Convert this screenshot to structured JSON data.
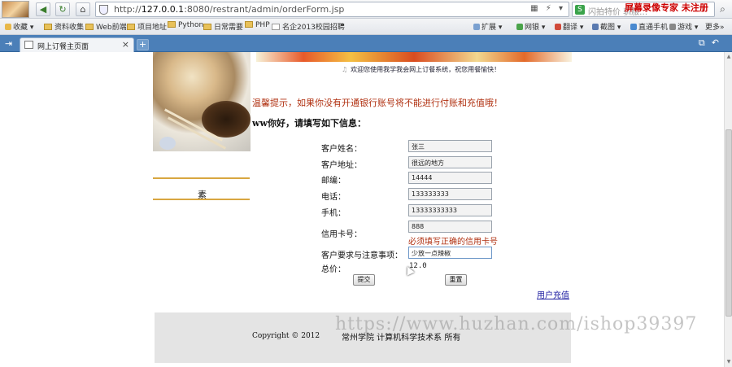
{
  "toolbar": {
    "url_prefix": "http://",
    "url_host": "127.0.0.1",
    "url_rest": ":8080/restrant/admin/orderForm.jsp",
    "search_placeholder": "闪拍特价 驯服…",
    "overlay_watermark": "屏幕录像专家  未注册"
  },
  "bookmarks": {
    "left": [
      "收藏",
      "资料收集",
      "Web前端",
      "项目地址",
      "Python",
      "日常需要",
      "PHP",
      "名企2013校园招聘"
    ],
    "more": "»",
    "right": [
      "扩展",
      "网银",
      "翻译",
      "截图",
      "直通手机",
      "游戏",
      "更多"
    ]
  },
  "tab": {
    "title": "网上订餐主页面",
    "close": "×",
    "new": "+"
  },
  "page": {
    "welcome": "欢迎您使用我学我会网上订餐系统，祝您用餐愉快！",
    "warning": "温馨提示，如果你没有开通银行账号将不能进行付账和充值哦！",
    "greeting": "ww你好，请填写如下信息：",
    "side_text": "素",
    "form": {
      "name_label": "客户姓名：",
      "name_value": "张三",
      "address_label": "客户地址：",
      "address_value": "很远的地方",
      "zip_label": "邮编：",
      "zip_value": "14444",
      "phone_label": "电话：",
      "phone_value": "133333333",
      "mobile_label": "手机：",
      "mobile_value": "13333333333",
      "card_label": "信用卡号：",
      "card_value": "888",
      "card_hint": "必须填写正确的信用卡号",
      "notes_label": "客户要求与注意事项：",
      "notes_value": "少放一点辣椒",
      "total_label": "总价：",
      "total_value": "12.0"
    },
    "submit_label": "提交",
    "reset_label": "重置",
    "recharge_link": "用户充值",
    "copyright": "Copyright © 2012",
    "school": "常州学院 计算机科学技术系 所有",
    "watermark": "https://www.huzhan.com/ishop39397"
  }
}
